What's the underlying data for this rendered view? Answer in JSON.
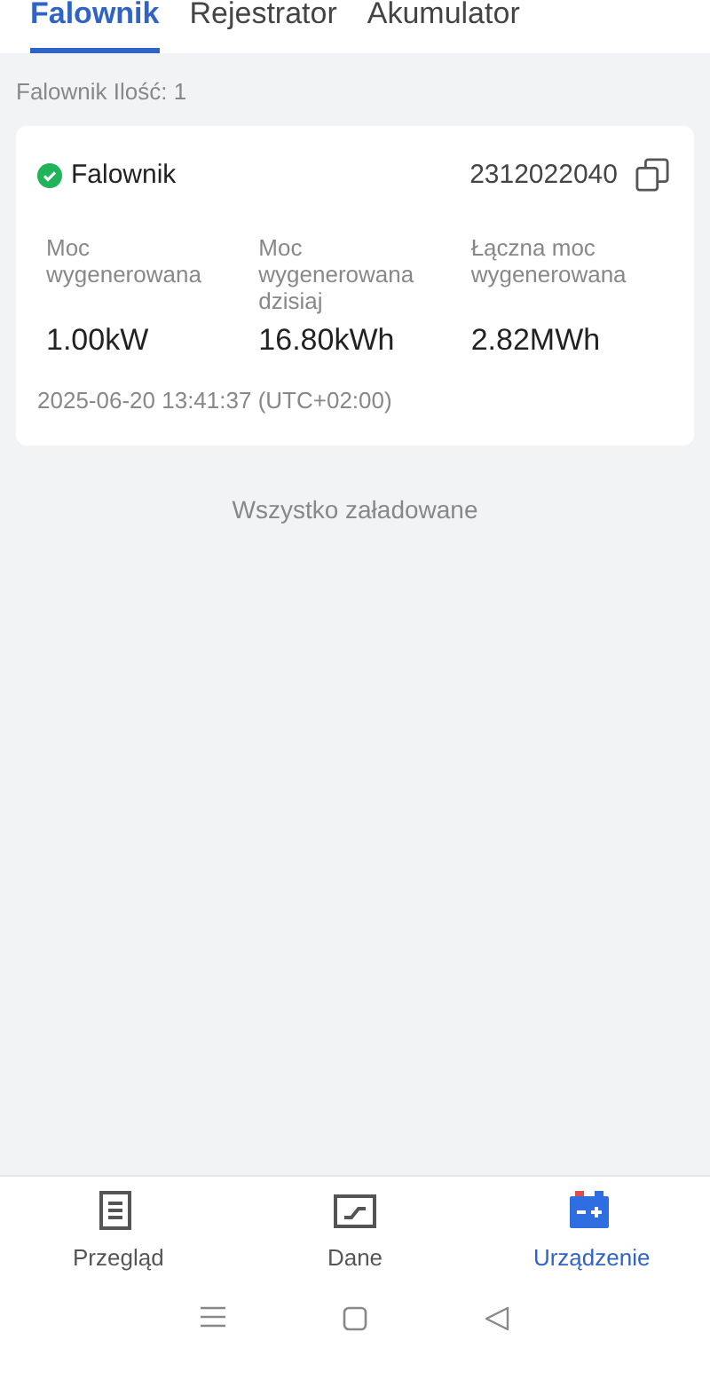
{
  "tabs": [
    {
      "label": "Falownik",
      "selected": true
    },
    {
      "label": "Rejestrator",
      "selected": false
    },
    {
      "label": "Akumulator",
      "selected": false
    }
  ],
  "count_label": "Falownik Ilość: 1",
  "devices": [
    {
      "name": "Falownik",
      "online": true,
      "serial": "2312022040",
      "metrics": [
        {
          "label": "Moc wygenerowana",
          "value": "1.00kW"
        },
        {
          "label": "Moc wygenerowana dzisiaj",
          "value": "16.80kWh"
        },
        {
          "label": "Łączna moc wygenerowana",
          "value": "2.82MWh"
        }
      ],
      "timestamp": "2025-06-20 13:41:37 (UTC+02:00)"
    }
  ],
  "list_end": "Wszystko załadowane",
  "bottom_nav": [
    {
      "label": "Przegląd",
      "kind": "overview",
      "selected": false
    },
    {
      "label": "Dane",
      "kind": "data",
      "selected": false
    },
    {
      "label": "Urządzenie",
      "kind": "device",
      "selected": true
    }
  ]
}
